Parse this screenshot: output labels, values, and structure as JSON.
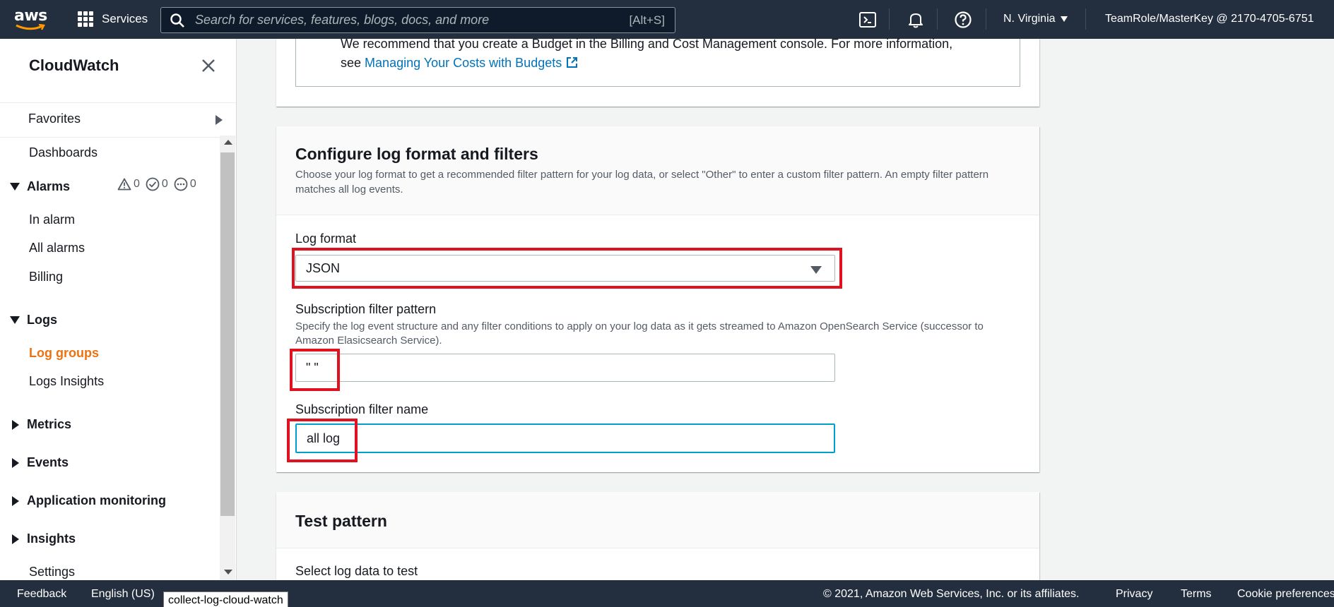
{
  "topnav": {
    "logo_text": "aws",
    "services_label": "Services",
    "search_placeholder": "Search for services, features, blogs, docs, and more",
    "search_shortcut": "[Alt+S]",
    "region": "N. Virginia",
    "account": "TeamRole/MasterKey @ 2170-4705-6751",
    "icons": [
      "cloudshell-icon",
      "bell-icon",
      "help-icon"
    ]
  },
  "sidebar": {
    "title": "CloudWatch",
    "favorites": "Favorites",
    "dashboards": "Dashboards",
    "alarms": {
      "label": "Alarms",
      "in_alarm_count": "0",
      "ok_count": "0",
      "insufficient_count": "0",
      "items": [
        "In alarm",
        "All alarms",
        "Billing"
      ]
    },
    "logs": {
      "label": "Logs",
      "items": [
        "Log groups",
        "Logs Insights"
      ],
      "active": "Log groups"
    },
    "metrics": "Metrics",
    "events": "Events",
    "app_monitoring": "Application monitoring",
    "insights": "Insights",
    "settings": "Settings"
  },
  "notice": {
    "text_line1": "We recommend that you create a Budget in the Billing and Cost Management console. For more information,",
    "text_see": "see",
    "link": "Managing Your Costs with Budgets"
  },
  "config": {
    "title": "Configure log format and filters",
    "description": "Choose your log format to get a recommended filter pattern for your log data, or select \"Other\" to enter a custom filter pattern. An empty filter pattern matches all log events.",
    "log_format_label": "Log format",
    "log_format_value": "JSON",
    "pattern_label": "Subscription filter pattern",
    "pattern_desc": "Specify the log event structure and any filter conditions to apply on your log data as it gets streamed to Amazon OpenSearch Service (successor to Amazon Elasicsearch Service).",
    "pattern_value": "\" \"",
    "name_label": "Subscription filter name",
    "name_value": "all log"
  },
  "test": {
    "title": "Test pattern",
    "select_label": "Select log data to test"
  },
  "footer": {
    "feedback": "Feedback",
    "language": "English (US)",
    "copyright": "© 2021, Amazon Web Services, Inc. or its affiliates.",
    "privacy": "Privacy",
    "terms": "Terms",
    "cookies": "Cookie preferences",
    "tooltip": "collect-log-cloud-watch"
  },
  "colors": {
    "nav_bg": "#232f3e",
    "active_orange": "#ec7211",
    "link_blue": "#0073bb",
    "highlight_red": "#e0121f",
    "focus_cyan": "#00a1c9"
  }
}
